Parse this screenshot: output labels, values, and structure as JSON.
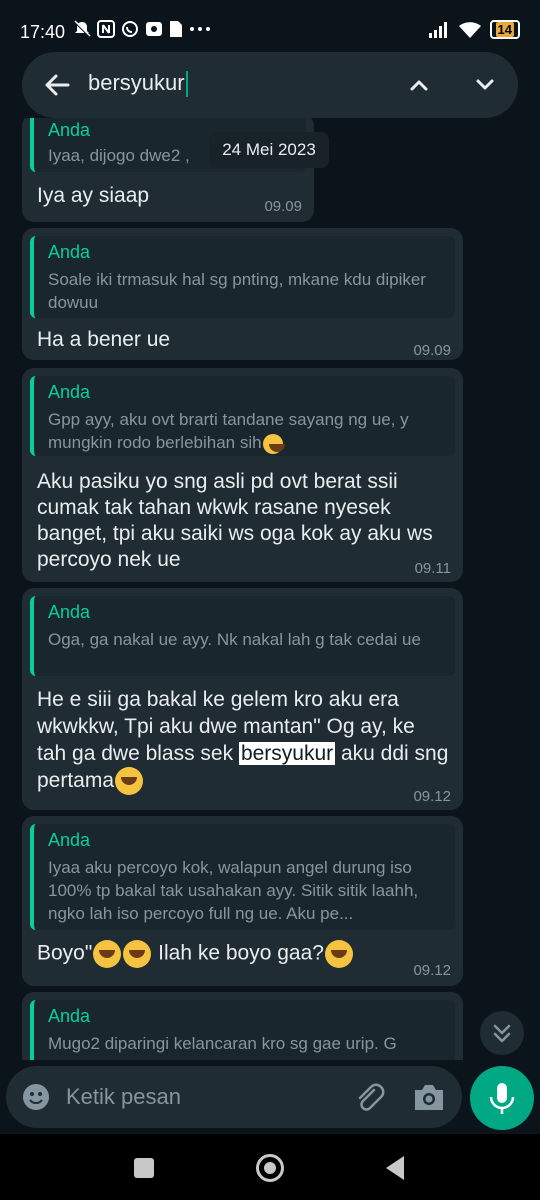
{
  "status_bar": {
    "time": "17:40",
    "battery": "14",
    "icons": [
      "mute-icon",
      "nfc-icon",
      "whatsapp-icon",
      "photo-icon",
      "file-icon",
      "more-icon"
    ]
  },
  "search": {
    "value": "bersyukur"
  },
  "date_chip": "24 Mei 2023",
  "messages": [
    {
      "quote_name": "Anda",
      "quote_text": "Iyaa, dijogo dwe2 ,",
      "text": "Iya ay siaap",
      "time": "09.09"
    },
    {
      "quote_name": "Anda",
      "quote_text": "Soale iki trmasuk hal sg pnting, mkane kdu dipiker dowuu",
      "text": "Ha a bener ue",
      "time": "09.09"
    },
    {
      "quote_name": "Anda",
      "quote_text": "Gpp ayy, aku ovt brarti tandane sayang ng ue, y mungkin rodo berlebihan sih",
      "text": "Aku pasiku yo sng asli pd ovt berat ssii cumak tak tahan wkwk rasane nyesek banget, tpi aku saiki ws oga kok ay aku ws percoyo nek ue",
      "time": "09.11"
    },
    {
      "quote_name": "Anda",
      "quote_text": "Oga, ga nakal ue ayy. Nk nakal lah g tak cedai ue",
      "text_before": "He e siii ga bakal ke gelem kro aku era wkwkkw, Tpi aku dwe mantan\" Og ay, ke tah ga dwe blass sek ",
      "text_highlight": "bersyukur",
      "text_after": " aku ddi sng pertama",
      "time": "09.12"
    },
    {
      "quote_name": "Anda",
      "quote_text": "Iyaa aku percoyo kok, walapun angel durung iso 100% tp bakal tak usahakan ayy. Sitik sitik laahh, ngko lah iso percoyo full ng ue. Aku pe...",
      "text_a": "Boyo\"",
      "text_b": " Ilah ke boyo gaa?",
      "time": "09.12"
    },
    {
      "quote_name": "Anda",
      "quote_text": "Mugo2 diparingi kelancaran kro sg gae urip. G"
    }
  ],
  "composer": {
    "placeholder": "Ketik pesan"
  },
  "colors": {
    "background": "#0b141a",
    "bubble": "#1f2c33",
    "accent": "#00a884",
    "quote_accent": "#06cf9c"
  }
}
